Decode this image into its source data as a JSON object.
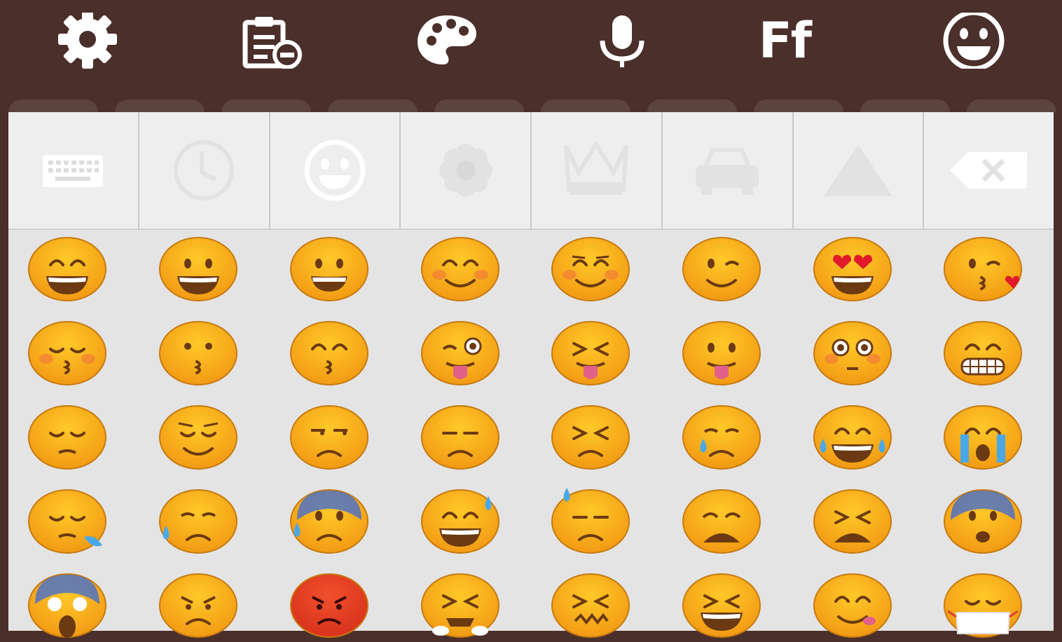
{
  "toolbar": {
    "items": [
      {
        "name": "settings-button",
        "icon": "gear-icon"
      },
      {
        "name": "clipboard-button",
        "icon": "clipboard-icon"
      },
      {
        "name": "theme-button",
        "icon": "palette-icon"
      },
      {
        "name": "voice-input-button",
        "icon": "microphone-icon"
      },
      {
        "name": "font-button",
        "icon": "font-icon",
        "label": "Ff"
      },
      {
        "name": "emoji-button",
        "icon": "smiley-icon"
      }
    ]
  },
  "categories": [
    {
      "name": "keyboard",
      "icon": "keyboard-icon"
    },
    {
      "name": "recent",
      "icon": "clock-icon"
    },
    {
      "name": "people",
      "icon": "smiley-icon",
      "selected": true
    },
    {
      "name": "nature",
      "icon": "flower-icon"
    },
    {
      "name": "objects",
      "icon": "crown-icon"
    },
    {
      "name": "places",
      "icon": "car-icon"
    },
    {
      "name": "symbols",
      "icon": "triangle-icon"
    },
    {
      "name": "delete",
      "icon": "backspace-icon"
    }
  ],
  "emoji_rows": [
    [
      "smile",
      "smiley",
      "grinning",
      "blush",
      "relaxed",
      "wink",
      "heart-eyes",
      "kissing-heart"
    ],
    [
      "kissing-closed-eyes",
      "kissing",
      "kissing-smiling-eyes",
      "stuck-out-tongue-winking-eye",
      "stuck-out-tongue-closed-eyes",
      "stuck-out-tongue",
      "flushed",
      "grin"
    ],
    [
      "pensive",
      "relieved",
      "unamused",
      "disappointed",
      "persevere",
      "cry",
      "joy",
      "sob"
    ],
    [
      "sleepy",
      "disappointed-relieved",
      "cold-sweat",
      "sweat-smile",
      "sweat",
      "weary",
      "tired-face",
      "fearful"
    ],
    [
      "scream",
      "angry",
      "rage",
      "triumph",
      "confounded",
      "laughing",
      "yum",
      "mask"
    ]
  ],
  "colors": {
    "toolbar_bg": "#4b2f2a",
    "panel_bg": "#e4e4e4",
    "category_bg": "#eeeeee",
    "emoji_yellow": "#ffc928",
    "emoji_orange": "#f29a14",
    "rage_red": "#d8321c"
  }
}
